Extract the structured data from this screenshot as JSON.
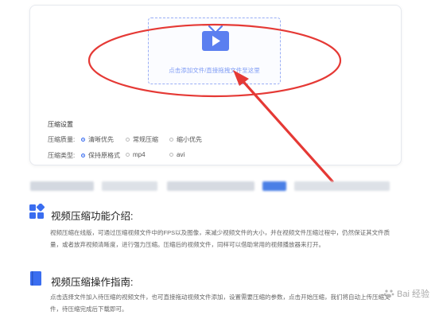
{
  "upload": {
    "hint": "点击添加文件/直接拖拽文件至这里",
    "icon": "tv-icon",
    "accent": "#5b7ff0"
  },
  "settings": {
    "title": "压缩设置",
    "quality": {
      "label": "压缩质量:",
      "options": [
        "清晰优先",
        "常规压缩",
        "缩小优先"
      ],
      "selected": "清晰优先"
    },
    "type": {
      "label": "压缩类型:",
      "options": [
        "保持原格式",
        "mp4",
        "avi"
      ],
      "selected": "保持原格式"
    }
  },
  "sections": [
    {
      "icon": "grid-apps-icon",
      "title": "视频压缩功能介绍:",
      "text": "视频压缩在线版，可通过压缩视频文件中的FPS以及图像，来减少视频文件的大小，并在视频文件压缩过程中，仍然保证其文件质量，或者放弃视频清晰度，进行强力压缩。压缩后的视频文件，同样可以借助常用的视频播放器来打开。"
    },
    {
      "icon": "book-icon",
      "title": "视频压缩操作指南:",
      "text": "点击选择文件加入待压缩的视频文件，也可直接拖动视频文件添加，设置需要压缩的参数，点击开始压缩，我们将自动上传压缩文件，待压缩完成后下载即可。"
    }
  ],
  "watermark": "Bai 经验",
  "annotation_color": "#e53935"
}
